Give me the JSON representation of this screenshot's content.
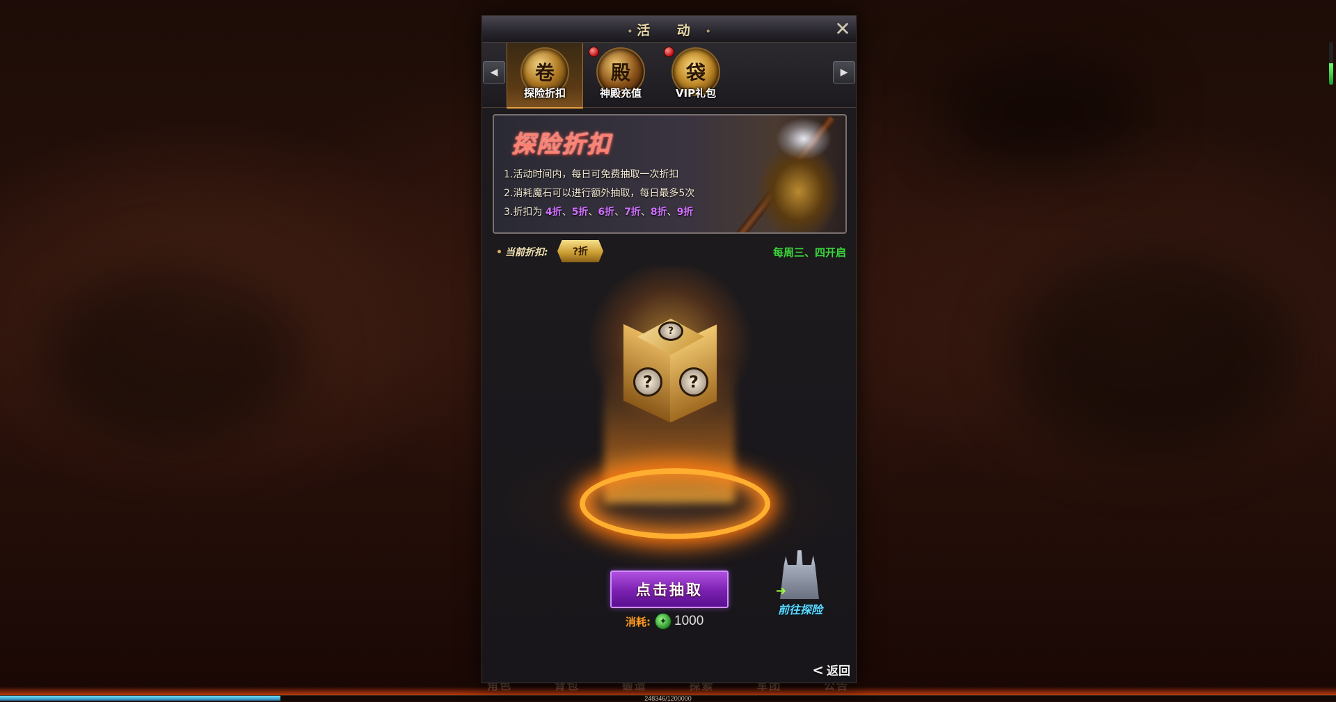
{
  "window": {
    "title": "活 动",
    "close_icon": "close-icon"
  },
  "tabs": [
    {
      "label": "探险折扣",
      "icon": "discount-scroll-icon",
      "active": true,
      "badge": false
    },
    {
      "label": "神殿充值",
      "icon": "temple-emblem-icon",
      "active": false,
      "badge": true
    },
    {
      "label": "VIP礼包",
      "icon": "gift-bag-icon",
      "active": false,
      "badge": true
    }
  ],
  "banner": {
    "title": "探险折扣",
    "rules": [
      {
        "text": "1.活动时间内，每日可免费抽取一次折扣"
      },
      {
        "text": "2.消耗魔石可以进行额外抽取，每日最多5次"
      },
      {
        "prefix": "3.折扣为 ",
        "discounts": [
          "4折",
          "5折",
          "6折",
          "7折",
          "8折",
          "9折"
        ],
        "separator": "、"
      }
    ]
  },
  "status": {
    "current_label": "当前折扣:",
    "current_value": "?折",
    "schedule": "每周三、四开启"
  },
  "action": {
    "draw_label": "点击抽取",
    "cost_label": "消耗:",
    "cost_value": "1000",
    "cost_icon": "magic-stone-icon",
    "explore_label": "前往探险",
    "back_label": "返回"
  },
  "hud": {
    "menu": [
      "角色",
      "背包",
      "锻造",
      "探索",
      "军团",
      "公告"
    ],
    "exp_text": "248346/1200000",
    "exp_progress": 0.21,
    "scroll_level": 0.5
  },
  "colors": {
    "accent_purple": "#7a20b0",
    "schedule_green": "#3ad83a",
    "gold": "#c8902c",
    "discount_highlight": "#d070ff"
  }
}
